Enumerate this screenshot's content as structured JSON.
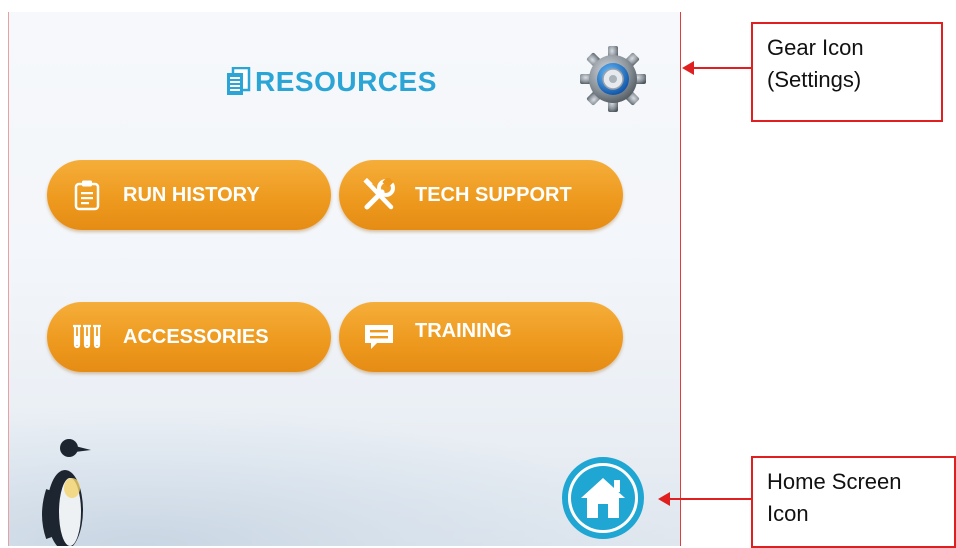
{
  "screen": {
    "title": "RESOURCES",
    "buttons": {
      "run_history": "RUN HISTORY",
      "tech_support": "TECH SUPPORT",
      "accessories": "ACCESSORIES",
      "training": "TRAINING"
    },
    "icons": {
      "title": "documents-icon",
      "settings": "gear-icon",
      "run_history": "clipboard-icon",
      "tech_support": "tools-icon",
      "accessories": "test-tubes-icon",
      "training": "chat-bubble-icon",
      "home": "home-icon"
    }
  },
  "annotations": {
    "gear": {
      "line1": "Gear Icon",
      "line2": "(Settings)"
    },
    "home": {
      "line1": "Home Screen",
      "line2": "Icon"
    }
  },
  "colors": {
    "accent_blue": "#2aa5d6",
    "button_orange": "#ee9a1f",
    "callout_red": "#e02020"
  }
}
